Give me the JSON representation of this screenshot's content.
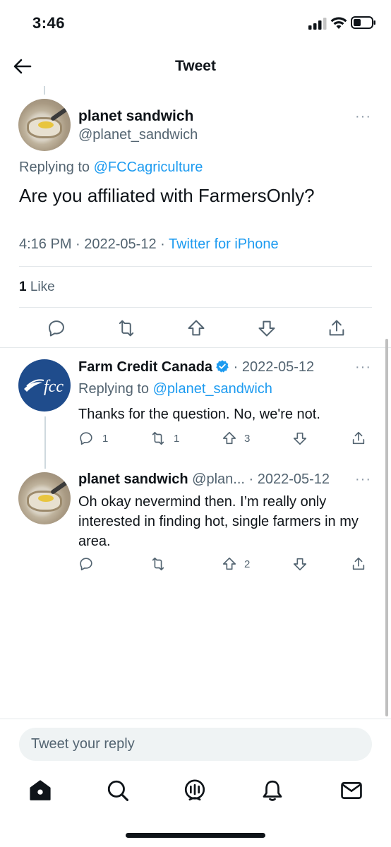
{
  "status_bar": {
    "time": "3:46"
  },
  "header": {
    "title": "Tweet"
  },
  "main_tweet": {
    "name": "planet sandwich",
    "handle": "@planet_sandwich",
    "replying_prefix": "Replying to ",
    "replying_to": "@FCCagriculture",
    "text": "Are you affiliated with FarmersOnly?",
    "time_date": "4:16 PM · 2022-05-12 · ",
    "source": "Twitter for iPhone",
    "like_count": "1",
    "like_label": " Like",
    "more": "···"
  },
  "replies": [
    {
      "name": "Farm Credit Canada",
      "handle_date": " · 2022-05-12",
      "replying_prefix": "Replying to ",
      "replying_to": "@planet_sandwich",
      "text": "Thanks for the question. No, we're not.",
      "reply_count": "1",
      "retweet_count": "1",
      "upvote_count": "3",
      "more": "···",
      "avatar_text": "fcc",
      "verified": true
    },
    {
      "name": "planet sandwich",
      "handle_date": " @plan... · 2022-05-12",
      "text": "Oh okay nevermind then. I’m really only interested in finding hot, single farmers in my area.",
      "reply_count": "",
      "retweet_count": "",
      "upvote_count": "2",
      "more": "···"
    }
  ],
  "compose": {
    "placeholder": "Tweet your reply"
  },
  "tab_bar": {
    "items": [
      "home-icon",
      "search-icon",
      "spaces-icon",
      "notifications-icon",
      "messages-icon"
    ]
  },
  "colors": {
    "accent": "#1d9bf0",
    "text": "#0f1419",
    "muted": "#536471",
    "fcc_blue": "#1f4c8c"
  }
}
